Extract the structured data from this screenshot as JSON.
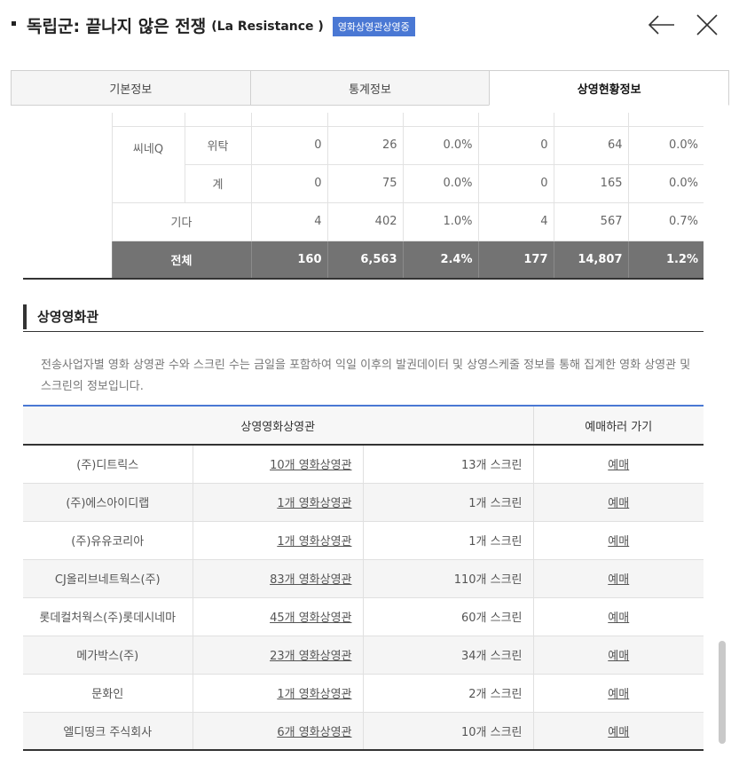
{
  "header": {
    "title": "독립군: 끝나지 않은 전쟁",
    "subtitle": "(La Resistance )",
    "badge": "영화상영관상영중",
    "back_icon": "arrow-left-icon",
    "close_icon": "close-icon"
  },
  "tabs": [
    {
      "label": "기본정보"
    },
    {
      "label": "통계정보"
    },
    {
      "label": "상영현황정보",
      "active": true
    }
  ],
  "stats": {
    "group_label": "씨네Q",
    "rows": [
      {
        "sub": "위탁",
        "c1": "0",
        "c2": "26",
        "c3": "0.0%",
        "c4": "0",
        "c5": "64",
        "c6": "0.0%"
      },
      {
        "sub": "계",
        "c1": "0",
        "c2": "75",
        "c3": "0.0%",
        "c4": "0",
        "c5": "165",
        "c6": "0.0%"
      }
    ],
    "etc": {
      "label": "기다",
      "c1": "4",
      "c2": "402",
      "c3": "1.0%",
      "c4": "4",
      "c5": "567",
      "c6": "0.7%"
    },
    "total": {
      "label": "전체",
      "c1": "160",
      "c2": "6,563",
      "c3": "2.4%",
      "c4": "177",
      "c5": "14,807",
      "c6": "1.2%"
    }
  },
  "section": {
    "title": "상영영화관",
    "description": "전송사업자별 영화 상영관 수와 스크린 수는 금일을 포함하여 익일 이후의 발권데이터 및 상영스케줄 정보를 통해 집계한 영화 상영관 및 스크린의 정보입니다."
  },
  "theater_table": {
    "headers": [
      "상영영화상영관",
      "예매하러 가기"
    ],
    "rows": [
      {
        "name": "(주)디트릭스",
        "theaters": "10개 영화상영관",
        "screens": "13개 스크린",
        "book": "예매"
      },
      {
        "name": "(주)에스아이디랩",
        "theaters": "1개 영화상영관",
        "screens": "1개 스크린",
        "book": "예매"
      },
      {
        "name": "(주)유유코리아",
        "theaters": "1개 영화상영관",
        "screens": "1개 스크린",
        "book": "예매"
      },
      {
        "name": "CJ올리브네트웍스(주)",
        "theaters": "83개 영화상영관",
        "screens": "110개 스크린",
        "book": "예매"
      },
      {
        "name": "롯데컬처웍스(주)롯데시네마",
        "theaters": "45개 영화상영관",
        "screens": "60개 스크린",
        "book": "예매"
      },
      {
        "name": "메가박스(주)",
        "theaters": "23개 영화상영관",
        "screens": "34개 스크린",
        "book": "예매"
      },
      {
        "name": "문화인",
        "theaters": "1개 영화상영관",
        "screens": "2개 스크린",
        "book": "예매"
      },
      {
        "name": "엘디띵크 주식회사",
        "theaters": "6개 영화상영관",
        "screens": "10개 스크린",
        "book": "예매"
      }
    ]
  },
  "scrollbar": {
    "position": 0.95
  }
}
